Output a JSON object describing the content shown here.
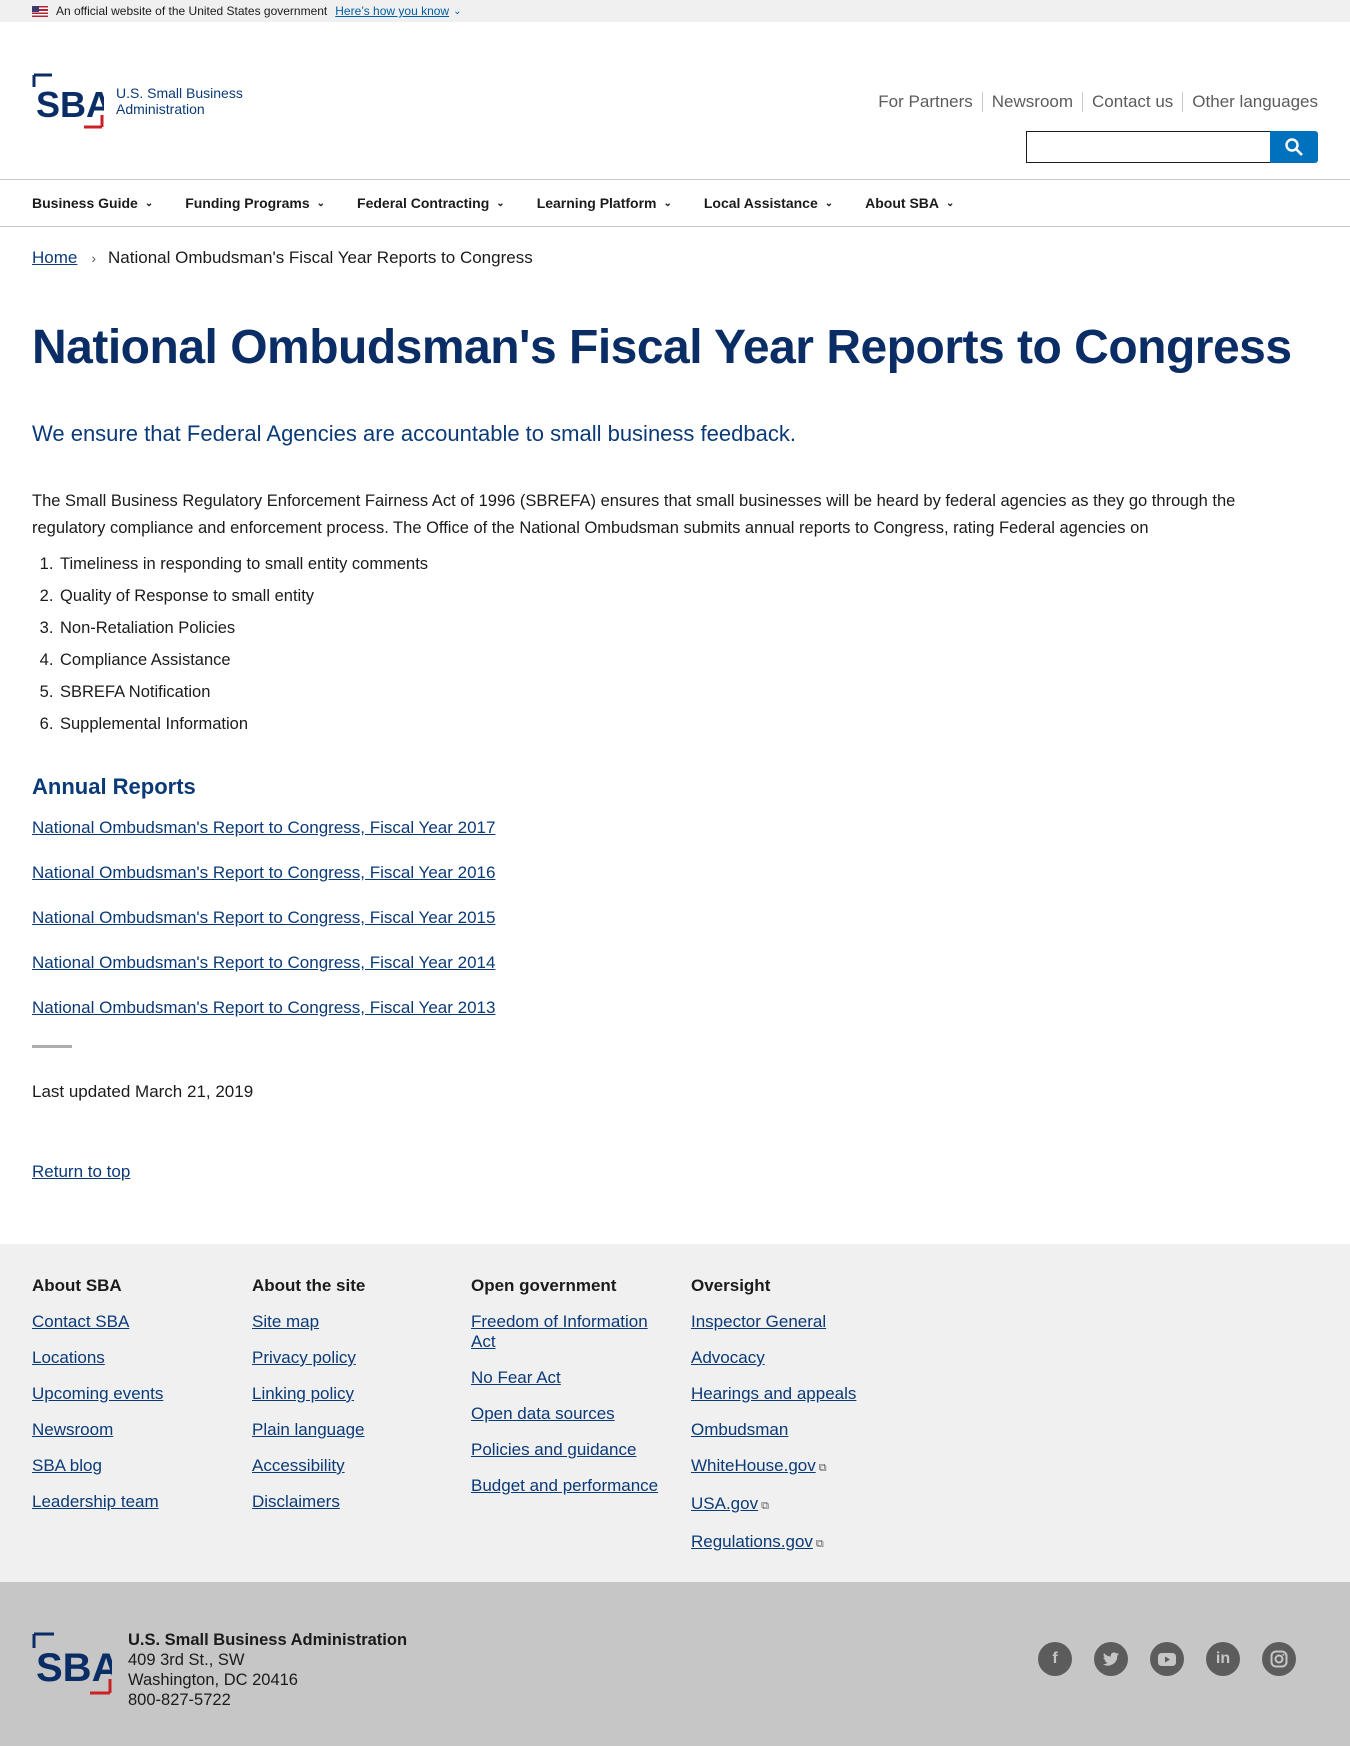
{
  "gov_banner": {
    "text": "An official website of the United States government",
    "how_link": "Here’s how you know"
  },
  "header": {
    "logo_letters": "SBA",
    "logo_text_line1": "U.S. Small Business",
    "logo_text_line2": "Administration",
    "utility_nav": [
      "For Partners",
      "Newsroom",
      "Contact us",
      "Other languages"
    ],
    "search": {
      "value": "",
      "placeholder": ""
    }
  },
  "main_nav": [
    "Business Guide",
    "Funding Programs",
    "Federal Contracting",
    "Learning Platform",
    "Local Assistance",
    "About SBA"
  ],
  "breadcrumb": {
    "home": "Home",
    "current": "National Ombudsman's Fiscal Year Reports to Congress"
  },
  "page": {
    "title": "National Ombudsman's Fiscal Year Reports to Congress",
    "lead": "We ensure that Federal Agencies are accountable to small business feedback.",
    "intro": "The Small Business Regulatory Enforcement Fairness Act of 1996 (SBREFA) ensures that small businesses will be heard by federal agencies as they go through the regulatory compliance and enforcement process. The Office of the National Ombudsman submits annual reports to Congress, rating Federal agencies on",
    "criteria": [
      "Timeliness in responding to small entity comments",
      "Quality of Response to small entity",
      "Non-Retaliation Policies",
      "Compliance Assistance",
      "SBREFA Notification",
      "Supplemental Information"
    ],
    "annual_reports_title": "Annual Reports",
    "reports": [
      "National Ombudsman's Report to Congress, Fiscal Year 2017",
      "National Ombudsman's Report to Congress, Fiscal Year 2016",
      "National Ombudsman's Report to Congress, Fiscal Year 2015",
      "National Ombudsman's Report to Congress, Fiscal Year 2014",
      "National Ombudsman's Report to Congress, Fiscal Year 2013"
    ],
    "last_updated": "Last updated March 21, 2019",
    "return_to_top": "Return to top"
  },
  "footer": {
    "columns": [
      {
        "title": "About SBA",
        "links": [
          "Contact SBA",
          "Locations",
          "Upcoming events",
          "Newsroom",
          "SBA blog",
          "Leadership team"
        ]
      },
      {
        "title": "About the site",
        "links": [
          "Site map",
          "Privacy policy",
          "Linking policy",
          "Plain language",
          "Accessibility",
          "Disclaimers"
        ]
      },
      {
        "title": "Open government",
        "links": [
          "Freedom of Information Act",
          "No Fear Act",
          "Open data sources",
          "Policies and guidance",
          "Budget and performance"
        ]
      },
      {
        "title": "Oversight",
        "links": [
          "Inspector General",
          "Advocacy",
          "Hearings and appeals",
          "Ombudsman",
          "WhiteHouse.gov",
          "USA.gov",
          "Regulations.gov"
        ]
      }
    ],
    "address": {
      "org": "U.S. Small Business Administration",
      "street": "409 3rd St., SW",
      "city": "Washington, DC 20416",
      "phone": "800-827-5722"
    },
    "social": [
      "facebook-icon",
      "twitter-icon",
      "youtube-icon",
      "linkedin-icon",
      "instagram-icon"
    ]
  },
  "colors": {
    "brand_navy": "#0b2d66",
    "link": "#0b3a78",
    "accent_blue": "#0071bc",
    "brand_red": "#cc2027"
  }
}
